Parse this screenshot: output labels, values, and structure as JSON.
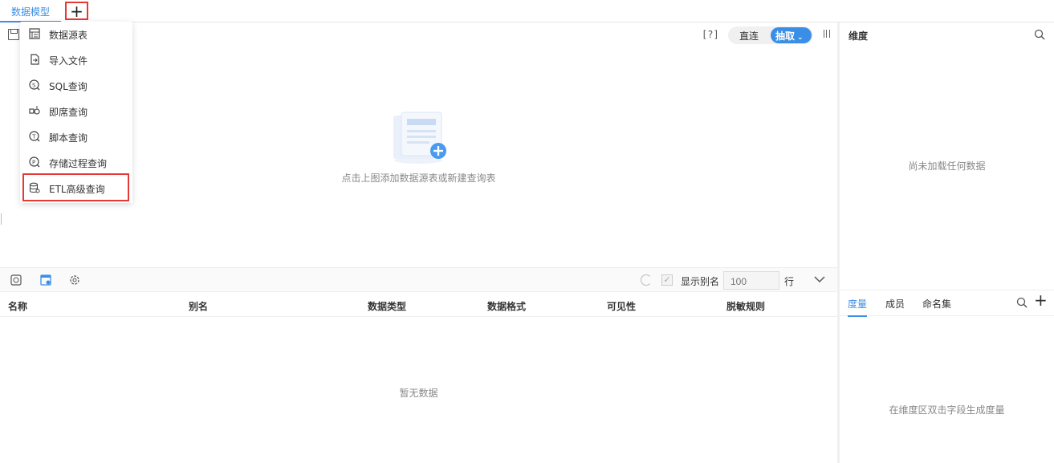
{
  "tabs": {
    "active_label": "数据模型",
    "add_symbol": "+"
  },
  "toolbar": {
    "help_label": "[?]",
    "mode_direct": "直连",
    "mode_extract": "抽取"
  },
  "canvas": {
    "empty_hint": "点击上图添加数据源表或新建查询表"
  },
  "menu": {
    "items": [
      {
        "label": "数据源表",
        "icon": "table-icon"
      },
      {
        "label": "导入文件",
        "icon": "import-file-icon"
      },
      {
        "label": "SQL查询",
        "icon": "sql-query-icon"
      },
      {
        "label": "即席查询",
        "icon": "adhoc-query-icon"
      },
      {
        "label": "脚本查询",
        "icon": "script-query-icon"
      },
      {
        "label": "存储过程查询",
        "icon": "stored-procedure-icon"
      },
      {
        "label": "ETL高级查询",
        "icon": "etl-query-icon"
      }
    ],
    "highlighted_item": "ETL高级查询"
  },
  "field_panel": {
    "show_alias_label": "显示别名",
    "rows_placeholder": "100",
    "rows_unit": "行",
    "columns": [
      "名称",
      "别名",
      "数据类型",
      "数据格式",
      "可见性",
      "脱敏规则"
    ],
    "empty_text": "暂无数据"
  },
  "dimension_panel": {
    "title": "维度",
    "empty_text": "尚未加载任何数据"
  },
  "measure_panel": {
    "tabs": [
      "度量",
      "成员",
      "命名集"
    ],
    "active_tab": "度量",
    "empty_text": "在维度区双击字段生成度量"
  },
  "colors": {
    "accent": "#3a8ee6",
    "highlight_border": "#e53935"
  }
}
